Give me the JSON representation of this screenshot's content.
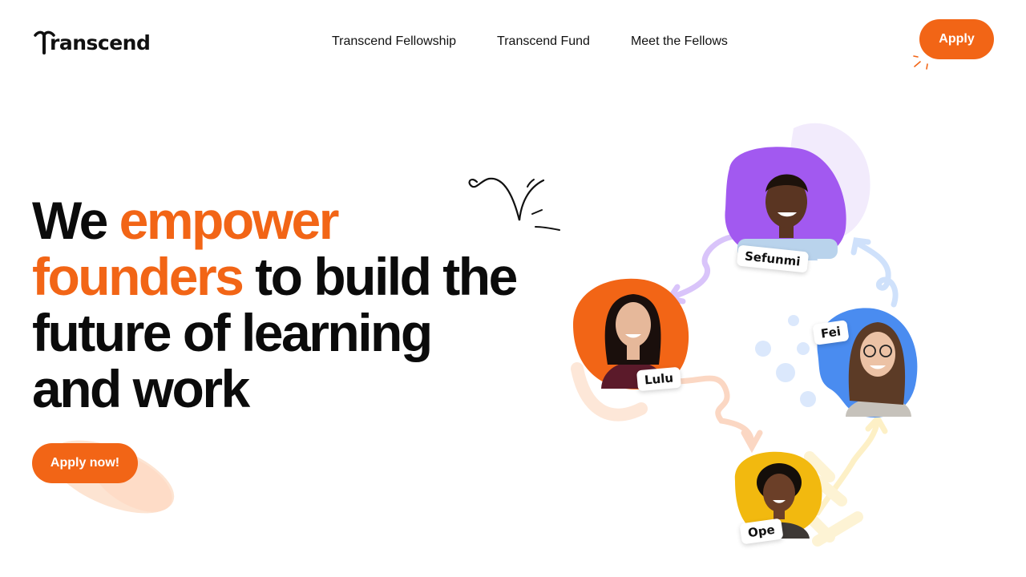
{
  "brand": {
    "name": "ranscend",
    "logo_alt": "Transcend",
    "accent": "#f26516"
  },
  "nav": {
    "items": [
      {
        "label": "Transcend Fellowship"
      },
      {
        "label": "Transcend Fund"
      },
      {
        "label": "Meet the Fellows"
      }
    ],
    "apply_label": "Apply"
  },
  "hero": {
    "title_part1": "We ",
    "title_accent": "empower founders",
    "title_part2": " to build the future of learning and work",
    "cta_label": "Apply now!"
  },
  "fellows": [
    {
      "name": "Sefunmi",
      "color": "#a259f0"
    },
    {
      "name": "Lulu",
      "color": "#f26516"
    },
    {
      "name": "Fei",
      "color": "#4a8cf0"
    },
    {
      "name": "Ope",
      "color": "#f2b90f"
    }
  ]
}
